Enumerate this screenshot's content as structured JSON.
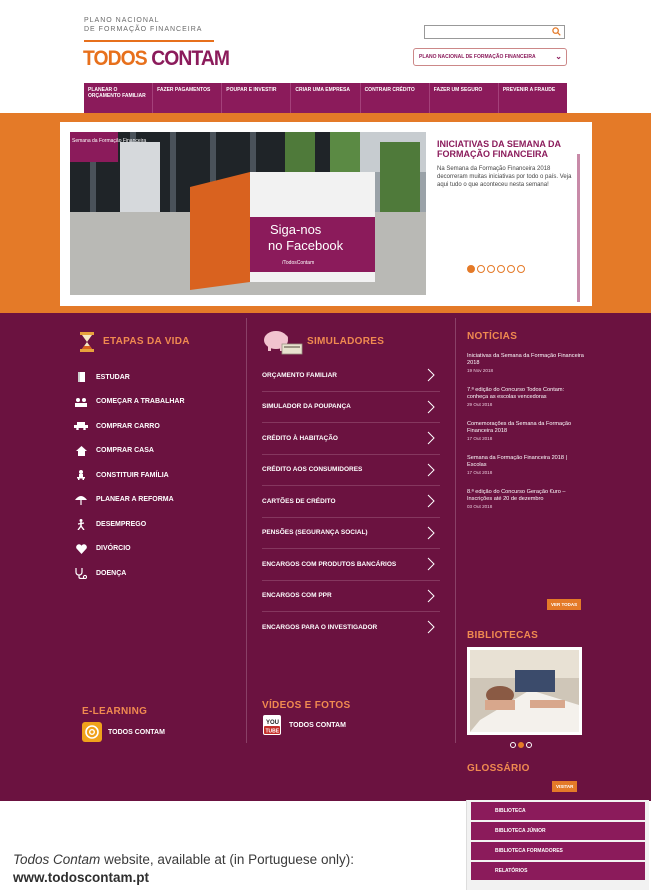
{
  "header": {
    "org_line1": "PLANO NACIONAL",
    "org_line2": "DE FORMAÇÃO FINANCEIRA",
    "logo_part1": "TODOS",
    "logo_part2": "CONTAM",
    "search_placeholder": "",
    "select_value": "PLANO NACIONAL DE FORMAÇÃO FINANCEIRA"
  },
  "nav": {
    "items": [
      {
        "label": "PLANEAR O ORÇAMENTO FAMILIAR"
      },
      {
        "label": "FAZER PAGAMENTOS"
      },
      {
        "label": "POUPAR E INVESTIR"
      },
      {
        "label": "CRIAR UMA EMPRESA"
      },
      {
        "label": "CONTRAIR CRÉDITO"
      },
      {
        "label": "FAZER UM SEGURO"
      },
      {
        "label": "PREVENIR A FRAUDE"
      }
    ]
  },
  "hero": {
    "photo_sign_line1": "Siga-nos",
    "photo_sign_line2": "no Facebook",
    "photo_sign_handle": "/TodosContam",
    "photo_banner": "Semana da Formação Financeira",
    "title": "INICIATIVAS DA SEMANA DA FORMAÇÃO FINANCEIRA",
    "text": "Na Semana da Formação Financeira 2018 decorreram muitas iniciativas por todo o país. Veja aqui tudo o que aconteceu nesta semana!",
    "dots_total": 6,
    "dots_active": 0
  },
  "etapas": {
    "title": "ETAPAS DA VIDA",
    "items": [
      {
        "label": "ESTUDAR",
        "icon": "book-icon"
      },
      {
        "label": "COMEÇAR A TRABALHAR",
        "icon": "people-icon"
      },
      {
        "label": "COMPRAR CARRO",
        "icon": "car-icon"
      },
      {
        "label": "COMPRAR CASA",
        "icon": "house-icon"
      },
      {
        "label": "CONSTITUIR FAMÍLIA",
        "icon": "family-icon"
      },
      {
        "label": "PLANEAR A REFORMA",
        "icon": "umbrella-icon"
      },
      {
        "label": "DESEMPREGO",
        "icon": "walking-person-icon"
      },
      {
        "label": "DIVÓRCIO",
        "icon": "heart-icon"
      },
      {
        "label": "DOENÇA",
        "icon": "stethoscope-icon"
      }
    ]
  },
  "simuladores": {
    "title": "SIMULADORES",
    "items": [
      {
        "label": "ORÇAMENTO FAMILIAR"
      },
      {
        "label": "SIMULADOR DA POUPANÇA"
      },
      {
        "label": "CRÉDITO À HABITAÇÃO"
      },
      {
        "label": "CRÉDITO AOS CONSUMIDORES"
      },
      {
        "label": "CARTÕES DE CRÉDITO"
      },
      {
        "label": "PENSÕES (SEGURANÇA SOCIAL)"
      },
      {
        "label": "ENCARGOS COM PRODUTOS BANCÁRIOS"
      },
      {
        "label": "ENCARGOS COM PPR"
      },
      {
        "label": "ENCARGOS PARA O INVESTIGADOR"
      }
    ]
  },
  "noticias": {
    "title": "NOTÍCIAS",
    "items": [
      {
        "text": "Iniciativas da Semana da Formação Financeira 2018",
        "date": "19 Nov 2018"
      },
      {
        "text": "7.ª edição do Concurso Todos Contam: conheça as escolas vencedoras",
        "date": "29 Out 2018"
      },
      {
        "text": "Comemorações da Semana da Formação Financeira 2018",
        "date": "17 Out 2018"
      },
      {
        "text": "Semana da Formação Financeira 2018 | Escolas",
        "date": "17 Out 2018"
      },
      {
        "text": "8.ª edição do Concurso Geração €uro – Inscrições até 20 de dezembro",
        "date": "03 Out 2018"
      }
    ],
    "button": "VER TODAS"
  },
  "bibliotecas": {
    "title": "BIBLIOTECAS",
    "dots_total": 3,
    "dots_active": 1
  },
  "glossario": {
    "title": "GLOSSÁRIO",
    "button": "VISITAR"
  },
  "elearning": {
    "title": "E-LEARNING",
    "link": "TODOS CONTAM"
  },
  "videos": {
    "title": "VÍDEOS E FOTOS",
    "link": "TODOS CONTAM",
    "icon_text": "You Tube"
  },
  "library_menu": {
    "items": [
      {
        "label": "BIBLIOTECA"
      },
      {
        "label": "BIBLIOTECA JÚNIOR"
      },
      {
        "label": "BIBLIOTECA FORMADORES"
      },
      {
        "label": "RELATÓRIOS"
      }
    ]
  },
  "caption": {
    "site_name": "Todos Contam",
    "text": " website, available at (in Portuguese only): ",
    "url": "www.todoscontam.pt"
  },
  "colors": {
    "purple": "#6b1240",
    "magenta": "#8b1b5b",
    "orange": "#e47a28"
  }
}
